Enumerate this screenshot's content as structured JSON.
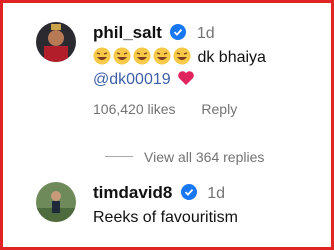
{
  "comments": [
    {
      "username": "phil_salt",
      "time": "1d",
      "text_suffix": "dk bhaiya",
      "mention": "@dk00019",
      "likes": "106,420 likes",
      "reply": "Reply"
    },
    {
      "username": "timdavid8",
      "time": "1d",
      "text": "Reeks of favouritism"
    }
  ],
  "view_replies": "View all 364 replies",
  "colors": {
    "border": "#e02424",
    "verified": "#1877f2",
    "mention": "#3d5fa8",
    "heart": "#e0245e"
  }
}
